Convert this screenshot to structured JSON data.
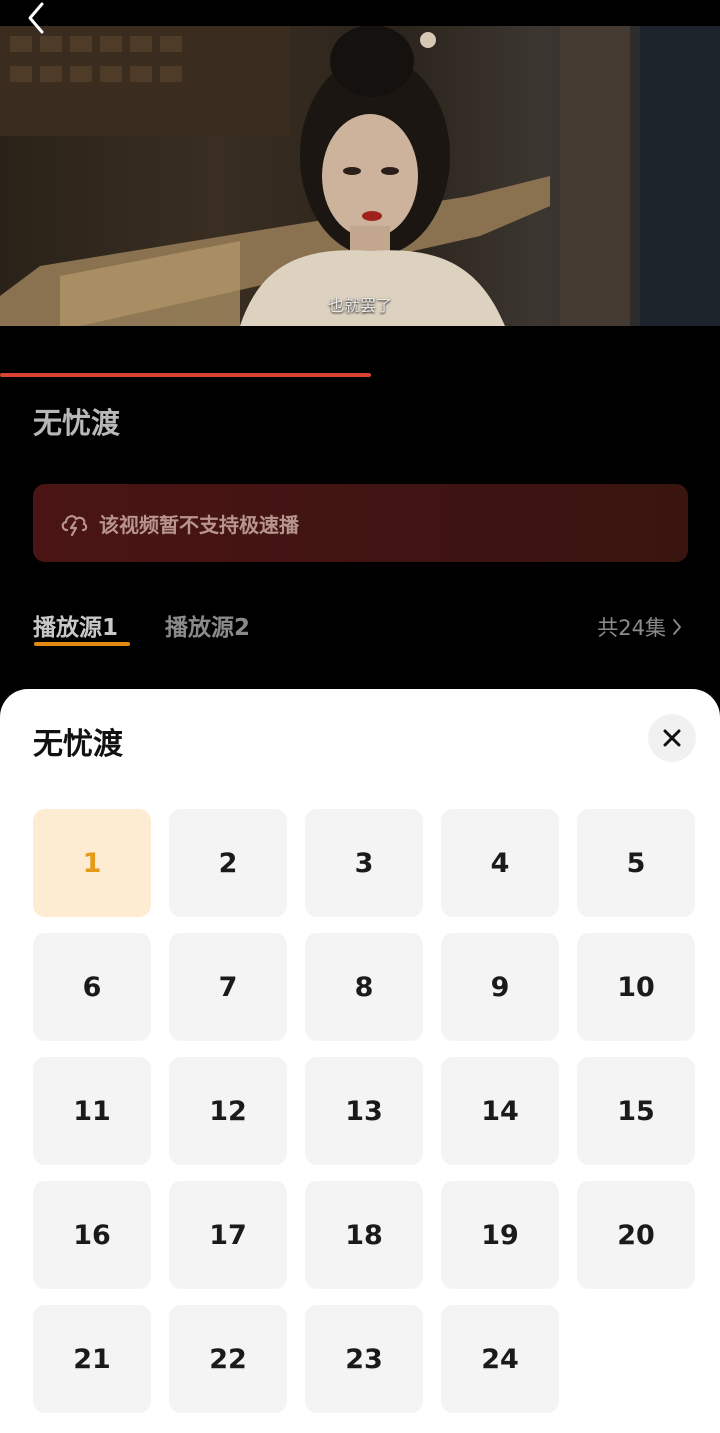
{
  "video": {
    "subtitle": "也就罢了"
  },
  "show": {
    "title": "无忧渡"
  },
  "notice": {
    "text": "该视频暂不支持极速播"
  },
  "sources": {
    "tabs": [
      {
        "label": "播放源1",
        "active": true
      },
      {
        "label": "播放源2",
        "active": false
      }
    ],
    "count_label": "共24集"
  },
  "episode_sheet": {
    "title": "无忧渡",
    "selected": "1",
    "episodes": [
      "1",
      "2",
      "3",
      "4",
      "5",
      "6",
      "7",
      "8",
      "9",
      "10",
      "11",
      "12",
      "13",
      "14",
      "15",
      "16",
      "17",
      "18",
      "19",
      "20",
      "21",
      "22",
      "23",
      "24"
    ]
  },
  "colors": {
    "accent": "#e08a14",
    "progress": "#d9432f",
    "active_episode_bg": "#fdebd2",
    "active_episode_text": "#e59a1a"
  },
  "icons": {
    "back": "chevron-left-icon",
    "notice": "cloud-lightning-icon",
    "count": "chevron-right-icon",
    "close": "close-icon"
  }
}
